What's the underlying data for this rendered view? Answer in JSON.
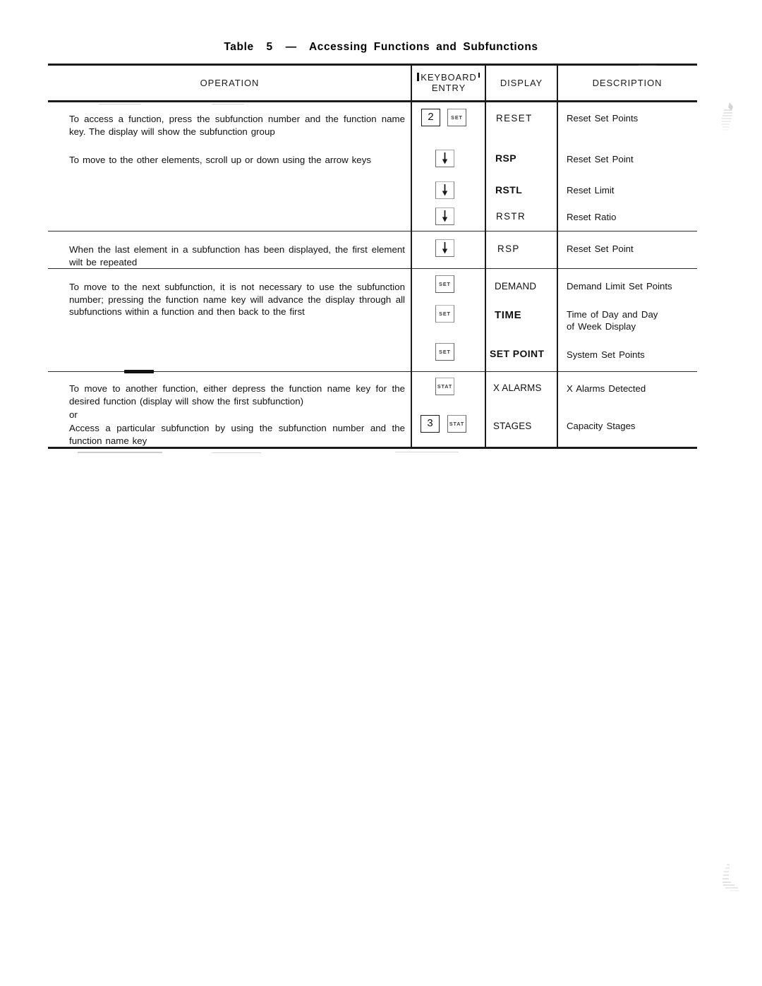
{
  "title": {
    "prefix": "Table",
    "number": "5",
    "dash": "—",
    "name": "Accessing Functions and Subfunctions",
    "full": "Table  5  —  Accessing  Functions  and  Subfunctions"
  },
  "table": {
    "columns": [
      {
        "id": "operation",
        "label": "OPERATION"
      },
      {
        "id": "keyboard",
        "label_line1": "KEYBOARD",
        "label_line2": "ENTRY"
      },
      {
        "id": "display",
        "label": "DISPLAY"
      },
      {
        "id": "description",
        "label": "DESCRIPTION"
      }
    ],
    "sections": [
      {
        "id": "section-1",
        "operations": [
          {
            "id": "op-access-function",
            "text": "To access a function, press the subfunction number and the function name key. The display will show the subfunction group"
          },
          {
            "id": "op-scroll-elements",
            "text": "To move to the other elements, scroll up or down using the arrow keys"
          }
        ],
        "rows": [
          {
            "keys": [
              {
                "type": "digit",
                "label": "2",
                "name": "key-2"
              },
              {
                "type": "label",
                "label": "SET",
                "name": "key-set"
              }
            ],
            "display": "RESET",
            "display_style": "spaced",
            "description": "Reset Set Points"
          },
          {
            "keys": [
              {
                "type": "arrow-down",
                "label": "↓",
                "name": "key-arrow-down"
              }
            ],
            "display": "RSP",
            "display_style": "semi",
            "description": "Reset Set Point"
          },
          {
            "keys": [
              {
                "type": "arrow-down",
                "label": "↓",
                "name": "key-arrow-down"
              }
            ],
            "display": "RSTL",
            "display_style": "semi",
            "description": "Reset Limit"
          },
          {
            "keys": [
              {
                "type": "arrow-down",
                "label": "↓",
                "name": "key-arrow-down"
              }
            ],
            "display": "RSTR",
            "display_style": "spaced",
            "description": "Reset Ratio"
          }
        ]
      },
      {
        "id": "section-2",
        "operations": [
          {
            "id": "op-last-element",
            "text": "When the last element in a subfunction has been displayed, the first element wilt be repeated"
          }
        ],
        "rows": [
          {
            "keys": [
              {
                "type": "arrow-down",
                "label": "↓",
                "name": "key-arrow-down"
              }
            ],
            "display": "RSP",
            "display_style": "spaced",
            "description": "Reset Set Point"
          }
        ]
      },
      {
        "id": "section-3",
        "operations": [
          {
            "id": "op-next-subfunction",
            "text": "To move to the next subfunction, it is not necessary to use the subfunction number; pressing the function name key will advance the display through all subfunctions within a function and then back to the first"
          }
        ],
        "rows": [
          {
            "keys": [
              {
                "type": "label",
                "label": "SET",
                "name": "key-set"
              }
            ],
            "display": "DEMAND",
            "display_style": "tight",
            "description": "Demand Limit Set Points"
          },
          {
            "keys": [
              {
                "type": "label",
                "label": "SET",
                "name": "key-set"
              }
            ],
            "display": "TIME",
            "display_style": "bold",
            "description_line1": "Time of Day and Day",
            "description_line2": "of Week Display"
          },
          {
            "keys": [
              {
                "type": "label",
                "label": "SET",
                "name": "key-set"
              }
            ],
            "display": "SET POINT",
            "display_style": "mixed",
            "description": "System Set Points"
          }
        ]
      },
      {
        "id": "section-4",
        "operations": [
          {
            "id": "op-another-function",
            "text": "To move to another function, either depress the function name key for the desired function (display will show the first subfunction)"
          },
          {
            "id": "op-or",
            "text": "or"
          },
          {
            "id": "op-particular-subfunction",
            "text": "Access a particular subfunction by using the subfunction number and the function name key"
          }
        ],
        "rows": [
          {
            "keys": [
              {
                "type": "label",
                "label": "STAT",
                "name": "key-stat"
              }
            ],
            "display": "X ALARMS",
            "display_style": "tight",
            "description": "X Alarms Detected"
          },
          {
            "keys": [
              {
                "type": "digit",
                "label": "3",
                "name": "key-3"
              },
              {
                "type": "label",
                "label": "STAT",
                "name": "key-stat"
              }
            ],
            "display": "STAGES",
            "display_style": "tight",
            "description": "Capacity Stages"
          }
        ]
      }
    ]
  }
}
